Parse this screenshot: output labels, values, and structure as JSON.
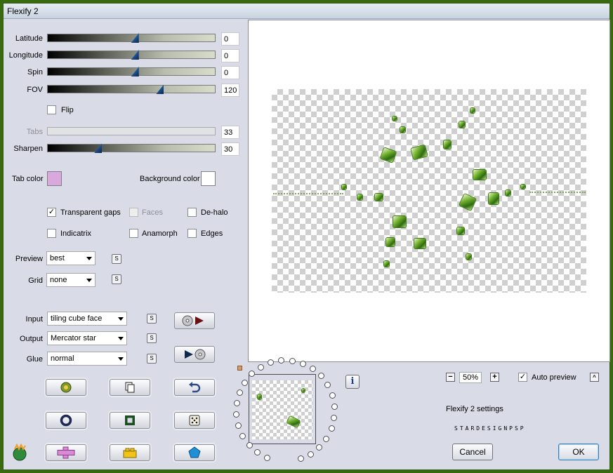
{
  "window": {
    "title": "Flexify 2"
  },
  "sliders": {
    "latitude": {
      "label": "Latitude",
      "value": "0",
      "level": 0.52
    },
    "longitude": {
      "label": "Longitude",
      "value": "0",
      "level": 0.52
    },
    "spin": {
      "label": "Spin",
      "value": "0",
      "level": 0.52
    },
    "fov": {
      "label": "FOV",
      "value": "120",
      "level": 0.67
    },
    "tabs": {
      "label": "Tabs",
      "value": "33"
    },
    "sharpen": {
      "label": "Sharpen",
      "value": "30",
      "level": 0.3
    }
  },
  "flip": {
    "label": "Flip",
    "checked": false
  },
  "colors": {
    "tab_color_label": "Tab color",
    "tab_color": "#d9a8dc",
    "background_color_label": "Background color",
    "background_color": "#ffffff"
  },
  "options": {
    "transparent_gaps": {
      "label": "Transparent gaps",
      "checked": true
    },
    "faces": {
      "label": "Faces",
      "checked": false,
      "disabled": true
    },
    "de_halo": {
      "label": "De-halo",
      "checked": false
    },
    "indicatrix": {
      "label": "Indicatrix",
      "checked": false
    },
    "anamorph": {
      "label": "Anamorph",
      "checked": false
    },
    "edges": {
      "label": "Edges",
      "checked": false
    }
  },
  "preview": {
    "label": "Preview",
    "value": "best"
  },
  "grid": {
    "label": "Grid",
    "value": "none"
  },
  "input": {
    "label": "Input",
    "value": "tiling cube face"
  },
  "output": {
    "label": "Output",
    "value": "Mercator star"
  },
  "glue": {
    "label": "Glue",
    "value": "normal"
  },
  "sync_label": "S",
  "zoom": {
    "value": "50%",
    "minus": "−",
    "plus": "+"
  },
  "auto_preview": {
    "label": "Auto preview",
    "checked": true
  },
  "settings_title": "Flexify 2 settings",
  "settings_name": "STARDESIGNPSP",
  "info_label": "i",
  "buttons": {
    "cancel": "Cancel",
    "ok": "OK"
  },
  "accent_colors": {
    "ok_border": "#3c7fb1",
    "window_border": "#3a6a10"
  }
}
